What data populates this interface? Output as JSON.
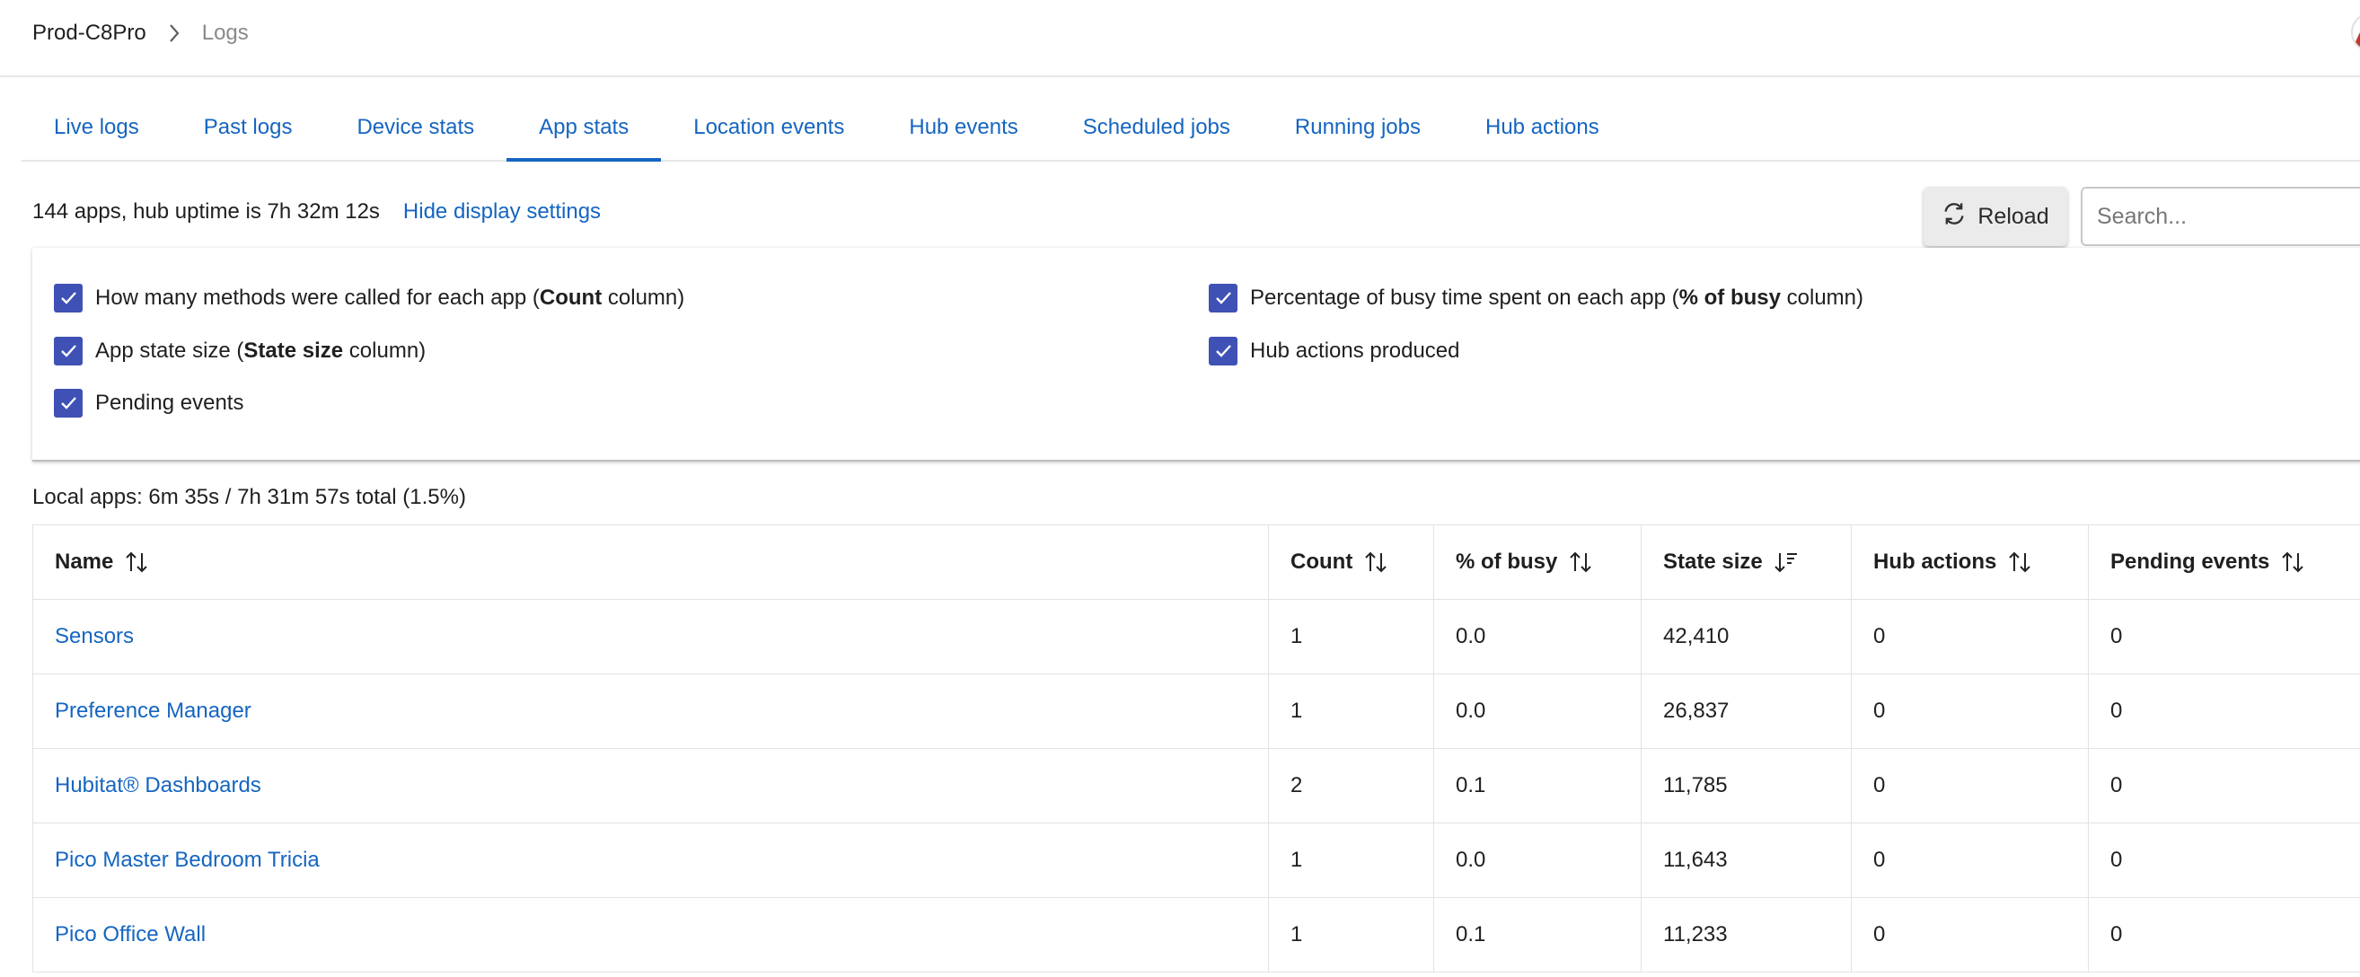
{
  "breadcrumb": {
    "app": "Prod-C8Pro",
    "current": "Logs"
  },
  "tabs": [
    "Live logs",
    "Past logs",
    "Device stats",
    "App stats",
    "Location events",
    "Hub events",
    "Scheduled jobs",
    "Running jobs",
    "Hub actions"
  ],
  "active_tab": "App stats",
  "summary": {
    "text": "144 apps, hub uptime is 7h 32m 12s",
    "toggle_link": "Hide display settings"
  },
  "toolbar": {
    "reload_label": "Reload",
    "search_placeholder": "Search..."
  },
  "settings": {
    "count": {
      "pre": "How many methods were called for each app (",
      "bold": "Count",
      "post": " column)",
      "checked": true
    },
    "state_size": {
      "pre": "App state size (",
      "bold": "State size",
      "post": " column)",
      "checked": true
    },
    "pending": {
      "label": "Pending events",
      "checked": true
    },
    "busy": {
      "pre": "Percentage of busy time spent on each app (",
      "bold": "% of busy",
      "post": " column)",
      "checked": true
    },
    "hub_actions": {
      "label": "Hub actions produced",
      "checked": true
    }
  },
  "local_apps_summary": "Local apps: 6m 35s / 7h 31m 57s total (1.5%)",
  "table": {
    "columns": [
      "Name",
      "Count",
      "% of busy",
      "State size",
      "Hub actions",
      "Pending events"
    ],
    "sorted_column": "State size",
    "sort_direction": "descending",
    "rows": [
      [
        "Sensors",
        "1",
        "0.0",
        "42,410",
        "0",
        "0"
      ],
      [
        "Preference Manager",
        "1",
        "0.0",
        "26,837",
        "0",
        "0"
      ],
      [
        "Hubitat® Dashboards",
        "2",
        "0.1",
        "11,785",
        "0",
        "0"
      ],
      [
        "Pico Master Bedroom Tricia",
        "1",
        "0.0",
        "11,643",
        "0",
        "0"
      ],
      [
        "Pico Office Wall",
        "1",
        "0.1",
        "11,233",
        "0",
        "0"
      ]
    ]
  },
  "colors": {
    "link": "#1565c0",
    "checkbox": "#3f51b5"
  }
}
